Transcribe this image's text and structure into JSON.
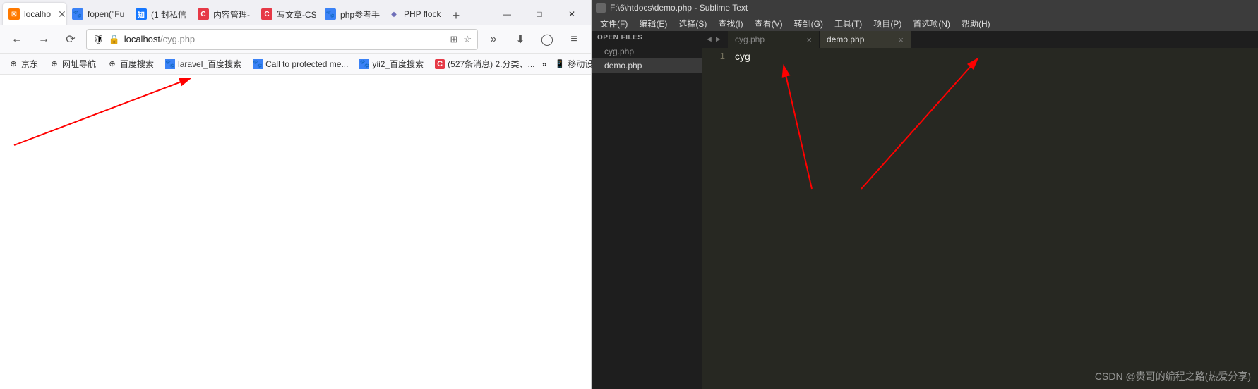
{
  "browser": {
    "tabs": [
      {
        "label": "localho",
        "favicon": "xampp",
        "active": true
      },
      {
        "label": "fopen(\"Fu",
        "favicon": "paw"
      },
      {
        "label": "(1 封私信",
        "favicon": "zhi"
      },
      {
        "label": "内容管理-",
        "favicon": "c"
      },
      {
        "label": "写文章-CS",
        "favicon": "c"
      },
      {
        "label": "php参考手",
        "favicon": "paw"
      },
      {
        "label": "PHP flock",
        "favicon": "php"
      }
    ],
    "window_controls": {
      "min": "—",
      "max": "□",
      "close": "✕"
    },
    "nav": {
      "back": "←",
      "fwd": "→",
      "reload": "⟳"
    },
    "address": {
      "shield": "🛡",
      "lock": "🔒",
      "host": "localhost",
      "path": "/cyg.php",
      "qr": "⊞",
      "star": "☆"
    },
    "toolbar": {
      "ext": "»",
      "menu": "≡",
      "download": "⬇",
      "account": "◯"
    },
    "bookmarks": [
      {
        "icon": "globe",
        "label": "京东"
      },
      {
        "icon": "globe",
        "label": "网址导航"
      },
      {
        "icon": "globe",
        "label": "百度搜索"
      },
      {
        "icon": "paw",
        "label": "laravel_百度搜索"
      },
      {
        "icon": "paw",
        "label": "Call to protected me..."
      },
      {
        "icon": "paw",
        "label": "yii2_百度搜索"
      },
      {
        "icon": "c",
        "label": "(527条消息) 2.分类、..."
      }
    ],
    "bm_overflow": "»",
    "bm_mobile": "移动设备上的书签"
  },
  "sublime": {
    "title": "F:\\6\\htdocs\\demo.php - Sublime Text",
    "menu": [
      "文件(F)",
      "编辑(E)",
      "选择(S)",
      "查找(I)",
      "查看(V)",
      "转到(G)",
      "工具(T)",
      "项目(P)",
      "首选项(N)",
      "帮助(H)"
    ],
    "sidebar": {
      "heading": "OPEN FILES",
      "files": [
        {
          "name": "cyg.php",
          "active": false
        },
        {
          "name": "demo.php",
          "active": true
        }
      ]
    },
    "tabs": {
      "nav_left": "◄",
      "nav_right": "►",
      "items": [
        {
          "name": "cyg.php",
          "active": false
        },
        {
          "name": "demo.php",
          "active": true
        }
      ]
    },
    "editor": {
      "line_number": "1",
      "code": "cyg"
    }
  },
  "watermark": "CSDN @贵哥的编程之路(热爱分享)"
}
